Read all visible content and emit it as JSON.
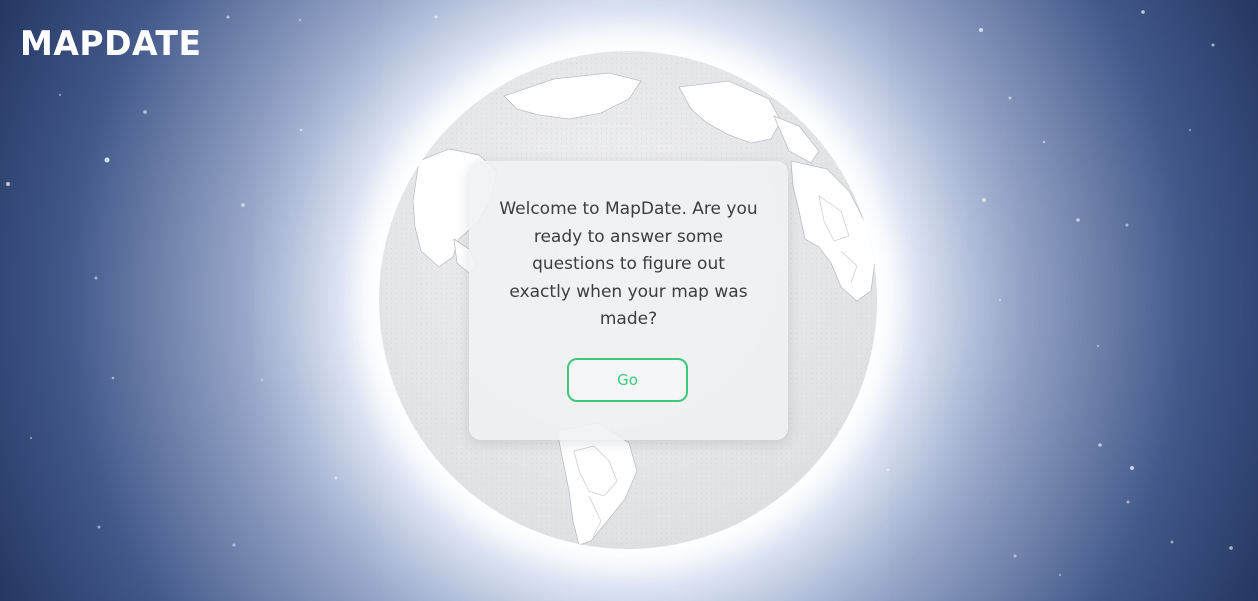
{
  "app": {
    "logo_text": "MAPDATE"
  },
  "dialog": {
    "message": "Welcome to MapDate. Are you ready to answer some questions to figure out exactly when your map was made?",
    "go_button_label": "Go"
  },
  "colors": {
    "background_dark": "#0f1e45",
    "globe_surface": "#e3e4e6",
    "accent_green": "#3ec97a",
    "dialog_text": "#3d3d3d"
  }
}
